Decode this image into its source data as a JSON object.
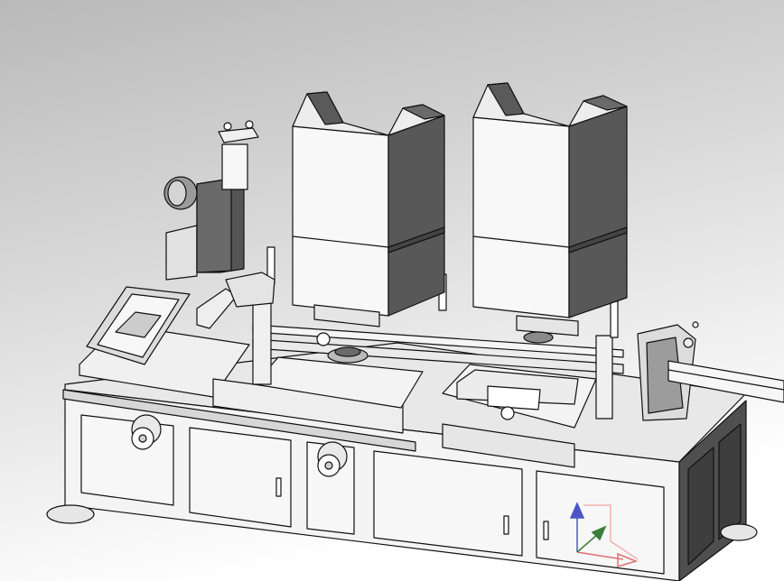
{
  "scene": {
    "background_top": "#b9b9b9",
    "background_bottom": "#ffffff",
    "line_color": "#111111",
    "light_face": "#f2f2f2",
    "mid_face": "#cfcfcf",
    "dark_face": "#5a5a5a",
    "darker_face": "#444444"
  },
  "triad": {
    "x_axis_color": "#e07070",
    "y_axis_color": "#3b7d3b",
    "z_axis_color": "#4a56c8"
  }
}
